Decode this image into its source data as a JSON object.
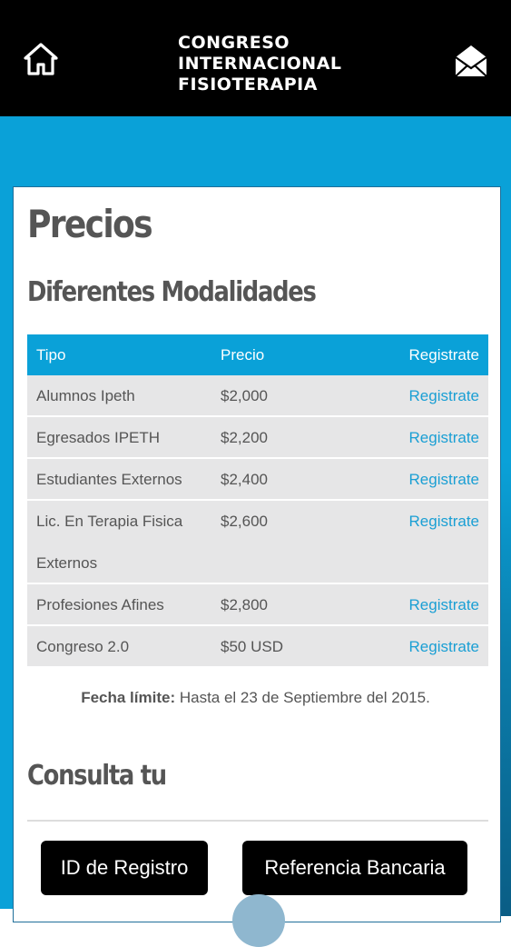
{
  "header": {
    "logo_lines": [
      "CONGRESO",
      "INTERNACIONAL",
      "FISIOTERAPIA"
    ],
    "home_icon": "home-icon",
    "mail_icon": "mail-icon"
  },
  "page": {
    "title": "Precios",
    "subtitle": "Diferentes Modalidades"
  },
  "table": {
    "columns": [
      "Tipo",
      "Precio",
      "Registrate"
    ],
    "rows": [
      {
        "tipo": "Alumnos Ipeth",
        "precio": "$2,000",
        "action": "Registrate"
      },
      {
        "tipo": "Egresados IPETH",
        "precio": "$2,200",
        "action": "Registrate"
      },
      {
        "tipo": "Estudiantes Externos",
        "precio": "$2,400",
        "action": "Registrate"
      },
      {
        "tipo": "Lic. En Terapia Fisica Externos",
        "precio": "$2,600",
        "action": "Registrate"
      },
      {
        "tipo": "Profesiones Afines",
        "precio": "$2,800",
        "action": "Registrate"
      },
      {
        "tipo": "Congreso 2.0",
        "precio": "$50 USD",
        "action": "Registrate"
      }
    ]
  },
  "deadline": {
    "label": "Fecha límite:",
    "text": " Hasta el 23 de Septiembre del 2015."
  },
  "consulta": {
    "heading": "Consulta tu",
    "buttons": [
      "ID de Registro",
      "Referencia Bancaria"
    ]
  },
  "colors": {
    "header_bg": "#000000",
    "accent_blue": "#0aa1d8",
    "link_blue": "#1a9fd4",
    "row_bg": "#e6e6e7",
    "text_gray": "#555555"
  }
}
